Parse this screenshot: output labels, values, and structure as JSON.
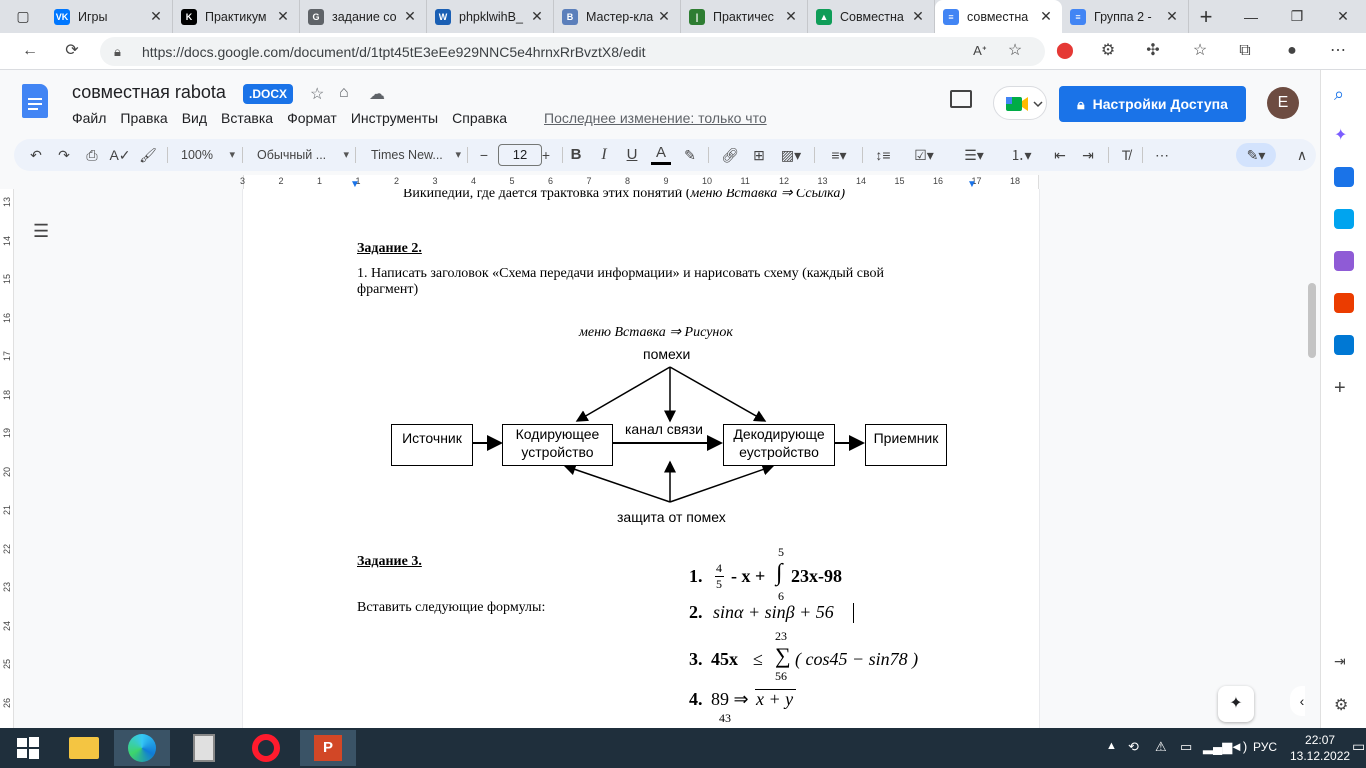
{
  "browser": {
    "tabs": [
      {
        "title": "Игры",
        "color": "#0077ff",
        "glyph": "VK"
      },
      {
        "title": "Практикум",
        "color": "#000000",
        "glyph": "K"
      },
      {
        "title": "задание со",
        "color": "#5f6368",
        "glyph": "G"
      },
      {
        "title": "phpklwihB_",
        "color": "#1a5fb4",
        "glyph": "W"
      },
      {
        "title": "Мастер-кла",
        "color": "#5b7fbb",
        "glyph": "B"
      },
      {
        "title": "Практичес",
        "color": "#2e7d32",
        "glyph": "|"
      },
      {
        "title": "Совместна",
        "color": "#0f9d58",
        "glyph": "▲"
      },
      {
        "title": "совместна",
        "color": "#4285f4",
        "glyph": "≡"
      },
      {
        "title": "Группа 2 -",
        "color": "#4285f4",
        "glyph": "≡"
      }
    ],
    "active_tab": 7,
    "url": "https://docs.google.com/document/d/1tpt45tE3eEe929NNC5e4hrnxRrBvztX8/edit"
  },
  "docs": {
    "title": "совместная rabota",
    "badge": ".DOCX",
    "menu": [
      "Файл",
      "Правка",
      "Вид",
      "Вставка",
      "Формат",
      "Инструменты",
      "Справка"
    ],
    "last_edit": "Последнее изменение: только что",
    "share_label": "Настройки Доступа",
    "avatar_letter": "E"
  },
  "toolbar": {
    "zoom": "100%",
    "style": "Обычный ...",
    "font": "Times New...",
    "font_size": "12"
  },
  "ruler": {
    "h_numbers": [
      "3",
      "2",
      "1",
      "1",
      "2",
      "3",
      "4",
      "5",
      "6",
      "7",
      "8",
      "9",
      "10",
      "11",
      "12",
      "13",
      "14",
      "15",
      "16",
      "17",
      "18"
    ],
    "v_numbers": [
      "13",
      "14",
      "15",
      "16",
      "17",
      "18",
      "19",
      "20",
      "21",
      "22",
      "23",
      "24",
      "25",
      "26"
    ]
  },
  "document": {
    "cut_line": "Википедии,   где дается трактовка этих понятий (",
    "cut_line_italic": "меню Вставка ⇒ Ссылка)",
    "task2_heading": "Задание 2.",
    "task2_text_line1": "1. Написать заголовок «Схема передачи информации» и нарисовать схему  (каждый свой",
    "task2_text_line2": "фрагмент)",
    "menu_hint": "меню Вставка ⇒ Рисунок",
    "diagram": {
      "noise": "помехи",
      "source": "Источник",
      "encoder_line1": "Кодирующее",
      "encoder_line2": "устройство",
      "channel": "канал связи",
      "decoder_line1": "Декодирующе",
      "decoder_line2": "еустройство",
      "receiver": "Приемник",
      "protection": "защита от помех"
    },
    "task3_heading": "Задание 3.",
    "task3_text": "Вставить следующие формулы:",
    "formulas": {
      "f1_num": "1.",
      "f1_frac_top": "4",
      "f1_frac_bot": "5",
      "f1_rest": "- x +",
      "f1_int_top": "5",
      "f1_int_bot": "6",
      "f1_tail": "23x-98",
      "f2_num": "2.",
      "f2_body": "sinα + sinβ + 56",
      "f3_num": "3.",
      "f3_lhs": "45x",
      "f3_le": "≤",
      "f3_sum_top": "23",
      "f3_sum_bot": "56",
      "f3_body": "( cos45 − sin78 )",
      "f4_num": "4.",
      "f4_lhs": "89 ⇒",
      "f4_rhs": "x + y",
      "f4_cut": "43"
    }
  },
  "taskbar": {
    "lang": "РУС",
    "time": "22:07",
    "date": "13.12.2022"
  }
}
